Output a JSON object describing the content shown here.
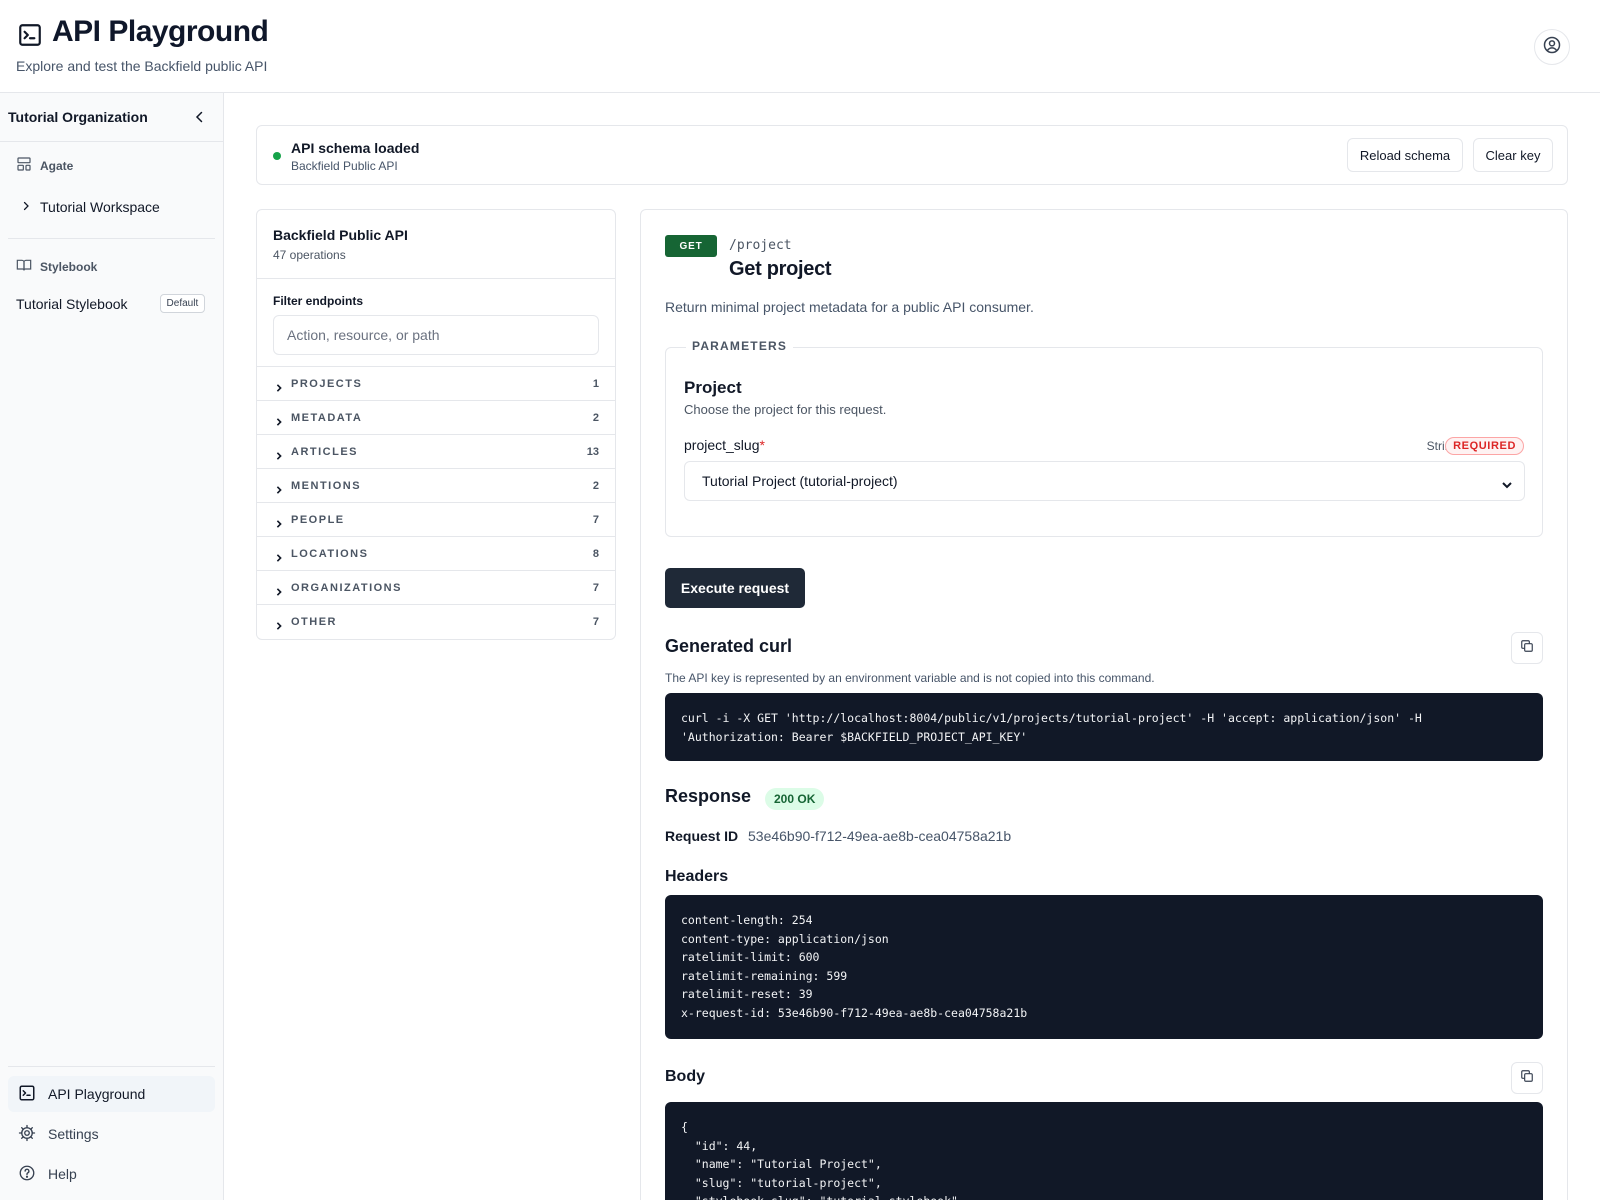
{
  "header": {
    "title": "API Playground",
    "subtitle": "Explore and test the Backfield public API",
    "icon": "terminal-icon",
    "user_icon": "user-circle-icon"
  },
  "sidebar": {
    "org_name": "Tutorial Organization",
    "collapse_icon": "chevron-left-icon",
    "sections": [
      {
        "label": "Agate",
        "icon": "layout-icon"
      },
      {
        "label": "Stylebook",
        "icon": "book-icon"
      }
    ],
    "workspace": "Tutorial Workspace",
    "stylebook_item": "Tutorial Stylebook",
    "stylebook_badge": "Default",
    "bottom_nav": [
      {
        "label": "API Playground",
        "icon": "terminal-icon",
        "active": true
      },
      {
        "label": "Settings",
        "icon": "gear-icon",
        "active": false
      },
      {
        "label": "Help",
        "icon": "help-circle-icon",
        "active": false
      }
    ]
  },
  "schema_status": {
    "title": "API schema loaded",
    "subtitle": "Backfield Public API",
    "status_color": "#16a34a",
    "reload_label": "Reload schema",
    "clear_label": "Clear key"
  },
  "endpoints": {
    "title": "Backfield Public API",
    "count_label": "47 operations",
    "filter_label": "Filter endpoints",
    "filter_placeholder": "Action, resource, or path",
    "groups": [
      {
        "label": "PROJECTS",
        "count": "1"
      },
      {
        "label": "METADATA",
        "count": "2"
      },
      {
        "label": "ARTICLES",
        "count": "13"
      },
      {
        "label": "MENTIONS",
        "count": "2"
      },
      {
        "label": "PEOPLE",
        "count": "7"
      },
      {
        "label": "LOCATIONS",
        "count": "8"
      },
      {
        "label": "ORGANIZATIONS",
        "count": "7"
      },
      {
        "label": "OTHER",
        "count": "7"
      }
    ]
  },
  "operation": {
    "method": "GET",
    "method_color": "#166534",
    "path": "/project",
    "title": "Get project",
    "description": "Return minimal project metadata for a public API consumer.",
    "parameters_legend": "PARAMETERS",
    "param_group_title": "Project",
    "param_group_desc": "Choose the project for this request.",
    "param_name": "project_slug",
    "param_required_marker": "*",
    "param_type": "String",
    "param_required_badge": "REQUIRED",
    "param_selected_value": "Tutorial Project (tutorial-project)",
    "execute_label": "Execute request"
  },
  "curl": {
    "title": "Generated curl",
    "note": "The API key is represented by an environment variable and is not copied into this command.",
    "command": "curl -i -X GET 'http://localhost:8004/public/v1/projects/tutorial-project' -H 'accept: application/json' -H\n'Authorization: Bearer $BACKFIELD_PROJECT_API_KEY'"
  },
  "response": {
    "title": "Response",
    "status": "200 OK",
    "status_color": "#166534",
    "request_id_label": "Request ID",
    "request_id": "53e46b90-f712-49ea-ae8b-cea04758a21b",
    "headers_title": "Headers",
    "headers_text": "content-length: 254\ncontent-type: application/json\nratelimit-limit: 600\nratelimit-remaining: 599\nratelimit-reset: 39\nx-request-id: 53e46b90-f712-49ea-ae8b-cea04758a21b",
    "body_title": "Body",
    "body_text": "{\n  \"id\": 44,\n  \"name\": \"Tutorial Project\",\n  \"slug\": \"tutorial-project\",\n  \"stylebook_slug\": \"tutorial-stylebook\","
  }
}
